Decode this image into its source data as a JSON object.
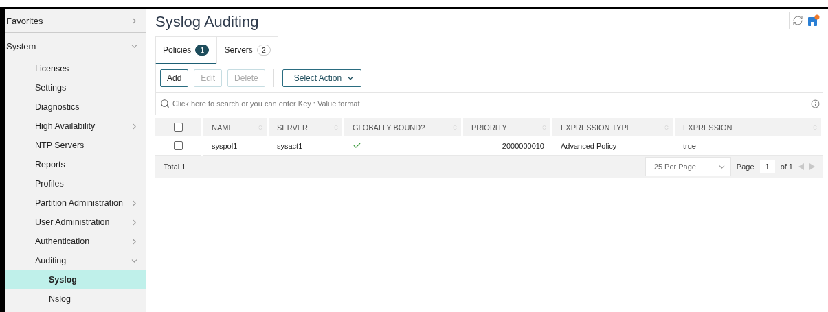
{
  "sidebar": {
    "sections": [
      {
        "label": "Favorites",
        "expanded": false
      },
      {
        "label": "System",
        "expanded": true,
        "items": [
          {
            "label": "Licenses",
            "selected": false
          },
          {
            "label": "Settings",
            "selected": false
          },
          {
            "label": "Diagnostics",
            "selected": false
          },
          {
            "label": "High Availability",
            "selected": false,
            "expanded": false
          },
          {
            "label": "NTP Servers",
            "selected": false
          },
          {
            "label": "Reports",
            "selected": false
          },
          {
            "label": "Profiles",
            "selected": false
          },
          {
            "label": "Partition Administration",
            "selected": false,
            "expanded": false
          },
          {
            "label": "User Administration",
            "selected": false,
            "expanded": false
          },
          {
            "label": "Authentication",
            "selected": false,
            "expanded": false
          },
          {
            "label": "Auditing",
            "selected": false,
            "expanded": true,
            "children": [
              {
                "label": "Syslog",
                "selected": true
              },
              {
                "label": "Nslog",
                "selected": false
              }
            ]
          }
        ]
      }
    ]
  },
  "page": {
    "title": "Syslog Auditing"
  },
  "tabs": [
    {
      "label": "Policies",
      "count": "1",
      "selected": true
    },
    {
      "label": "Servers",
      "count": "2",
      "selected": false
    }
  ],
  "toolbar": {
    "buttons": [
      {
        "label": "Add",
        "disabled": false
      },
      {
        "label": "Edit",
        "disabled": true
      },
      {
        "label": "Delete",
        "disabled": true
      }
    ],
    "action": "Select Action"
  },
  "search": {
    "placeholder": "Click here to search or you can enter Key : Value format"
  },
  "table": {
    "all_checked": false,
    "columns": [
      "NAME",
      "SERVER",
      "GLOBALLY BOUND?",
      "PRIORITY",
      "EXPRESSION TYPE",
      "EXPRESSION"
    ],
    "rows": [
      {
        "checked": false,
        "name": "syspol1",
        "server": "sysact1",
        "globally_bound": true,
        "priority": "2000000010",
        "expression_type": "Advanced Policy",
        "expression": "true"
      }
    ]
  },
  "footer": {
    "total": "Total 1",
    "per_page": "25 Per Page",
    "page_label": "Page",
    "page": "1",
    "of": "of 1"
  }
}
